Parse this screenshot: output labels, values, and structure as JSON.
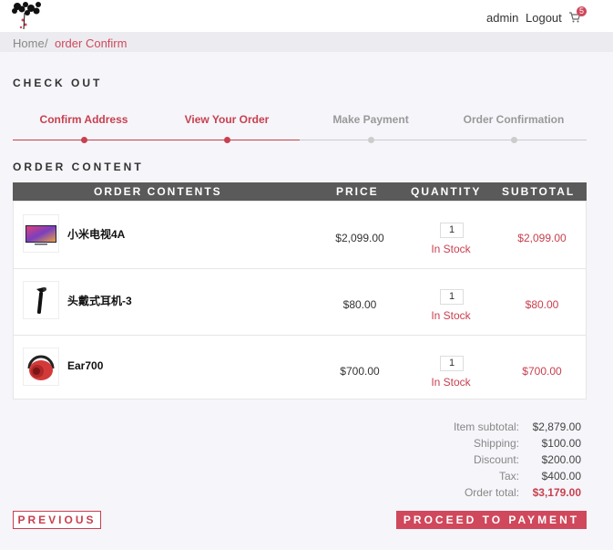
{
  "header": {
    "user_name": "admin",
    "logout_label": "Logout",
    "cart_count": "5"
  },
  "breadcrumb": {
    "home": "Home",
    "separator": "/",
    "current": "order Confirm"
  },
  "checkout_title": "CHECK OUT",
  "steps": [
    {
      "label": "Confirm Address",
      "active": true
    },
    {
      "label": "View Your Order",
      "active": true
    },
    {
      "label": "Make Payment",
      "active": false
    },
    {
      "label": "Order Confirmation",
      "active": false
    }
  ],
  "order_content_title": "ORDER CONTENT",
  "table": {
    "headers": [
      "ORDER CONTENTS",
      "PRICE",
      "QUANTITY",
      "SUBTOTAL"
    ],
    "rows": [
      {
        "name": "小米电视4A",
        "price": "$2,099.00",
        "quantity": "1",
        "stock": "In Stock",
        "subtotal": "$2,099.00",
        "icon": "tv-icon"
      },
      {
        "name": "头戴式耳机-3",
        "price": "$80.00",
        "quantity": "1",
        "stock": "In Stock",
        "subtotal": "$80.00",
        "icon": "earpiece-icon"
      },
      {
        "name": "Ear700",
        "price": "$700.00",
        "quantity": "1",
        "stock": "In Stock",
        "subtotal": "$700.00",
        "icon": "headphones-icon"
      }
    ]
  },
  "summary": {
    "item_subtotal_label": "Item subtotal:",
    "item_subtotal": "$2,879.00",
    "shipping_label": "Shipping:",
    "shipping": "$100.00",
    "discount_label": "Discount:",
    "discount": "$200.00",
    "tax_label": "Tax:",
    "tax": "$400.00",
    "order_total_label": "Order total:",
    "order_total": "$3,179.00"
  },
  "buttons": {
    "previous": "PREVIOUS",
    "proceed": "PROCEED TO PAYMENT"
  },
  "colors": {
    "accent": "#d0485c",
    "table_header": "#5a5a5a",
    "inactive": "#999999"
  }
}
